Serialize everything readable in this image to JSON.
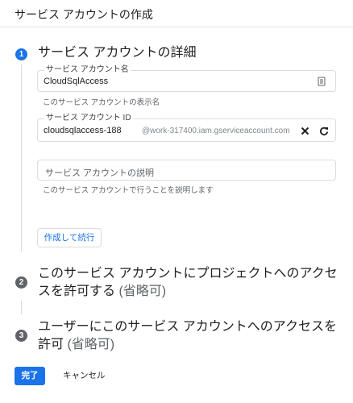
{
  "header": {
    "title": "サービス アカウントの作成"
  },
  "steps": [
    {
      "number": "1",
      "title": "サービス アカウントの詳細",
      "fields": {
        "name": {
          "label": "サービス アカウント名",
          "value": "CloudSqlAccess",
          "hint": "このサービス アカウントの表示名",
          "icon": "id-card-icon"
        },
        "id": {
          "label": "サービス アカウント ID",
          "value": "cloudsqlaccess-188",
          "suffix": "@work-317400.iam.gserviceaccount.com",
          "hint": "",
          "icons": [
            "close-icon",
            "refresh-icon"
          ]
        },
        "description": {
          "placeholder": "サービス アカウントの説明",
          "hint": "このサービス アカウントで行うことを説明します"
        }
      },
      "continue_label": "作成して続行"
    },
    {
      "number": "2",
      "title_line1": "このサービス アカウントにプロジェクトへのアクセ",
      "title_line2": "スを許可する",
      "optional": "(省略可)"
    },
    {
      "number": "3",
      "title_line1": "ユーザーにこのサービス アカウントへのアクセスを",
      "title_line2": "許可",
      "optional": "(省略可)"
    }
  ],
  "footer": {
    "done_label": "完了",
    "cancel_label": "キャンセル"
  },
  "colors": {
    "accent": "#1a73e8",
    "inactive_step": "#5f6368",
    "border": "#dadce0"
  }
}
